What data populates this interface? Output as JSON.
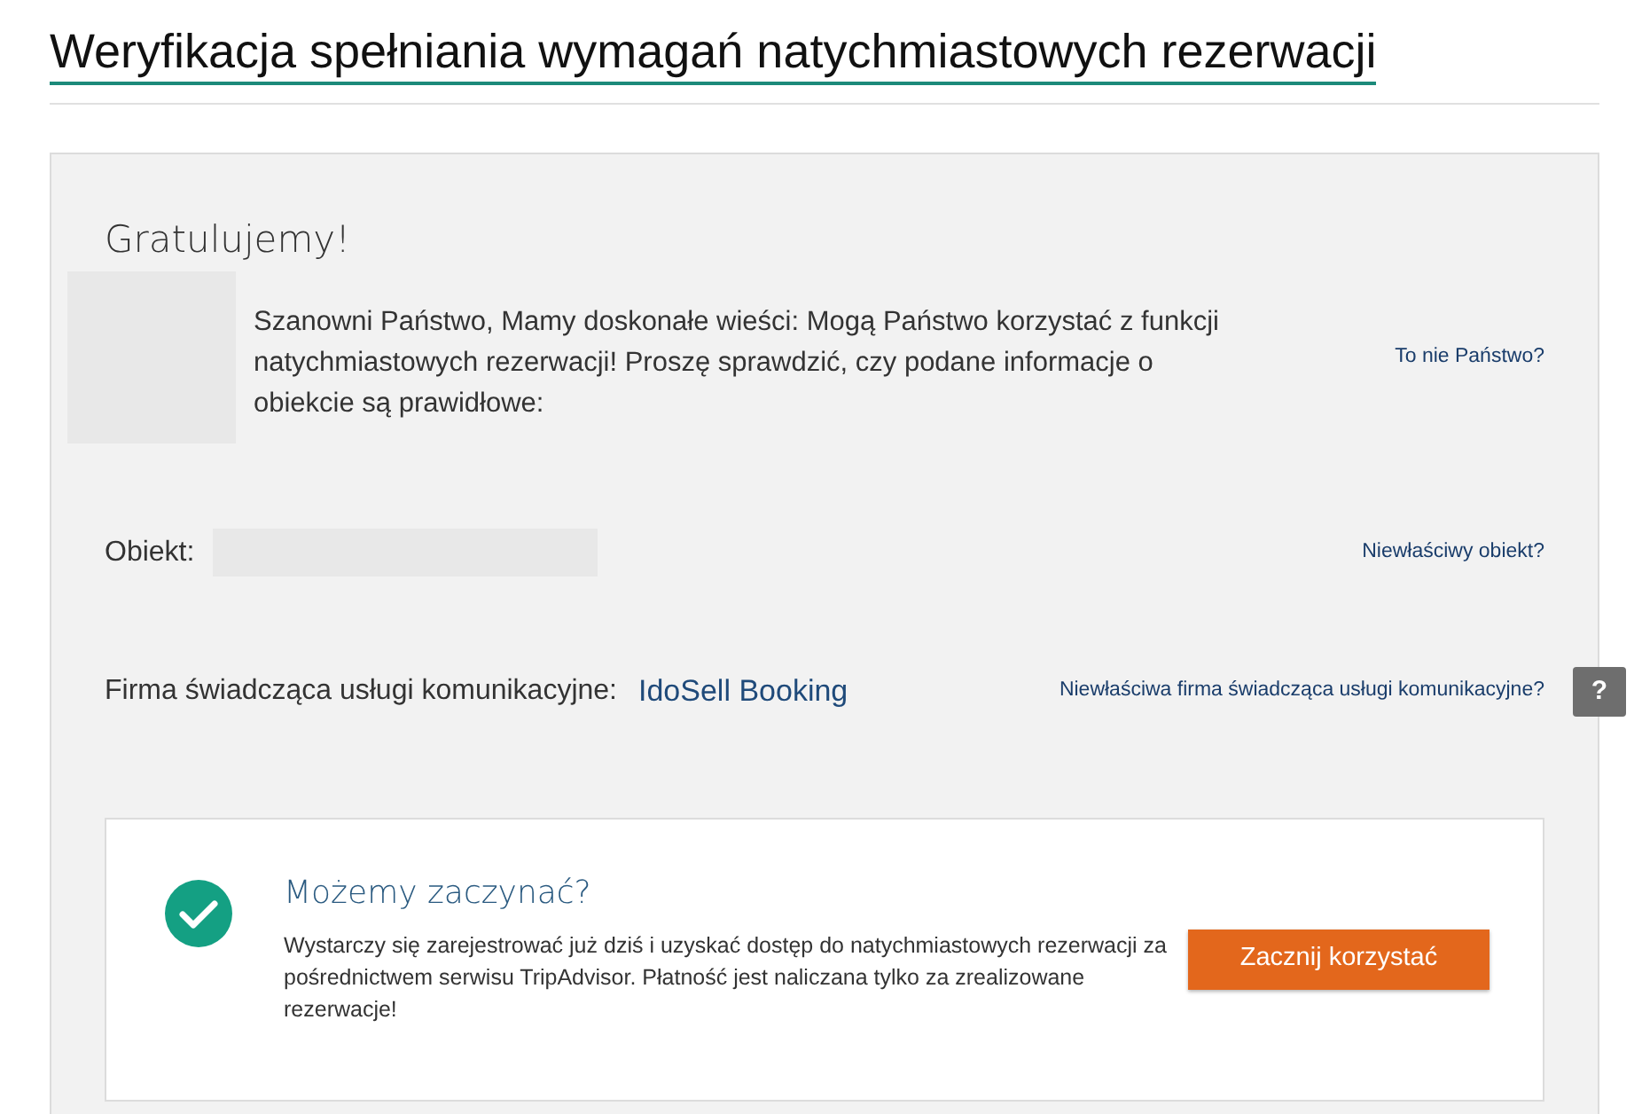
{
  "title": "Weryfikacja spełniania wymagań natychmiastowych rezerwacji",
  "panel": {
    "heading": "Gratulujemy!",
    "message": "Szanowni Państwo, Mamy doskonałe wieści: Mogą Państwo korzystać z funkcji natychmiastowych rezerwacji! Proszę sprawdzić, czy podane informacje o obiekcie są prawidłowe:",
    "message_link": "To nie Państwo?",
    "fields": [
      {
        "kind": "blank",
        "label": "Obiekt:",
        "link": "Niewłaściwy obiekt?"
      },
      {
        "kind": "value",
        "label": "Firma świadcząca usługi komunikacyjne:",
        "value": "IdoSell Booking",
        "link": "Niewłaściwa firma świadcząca usługi komunikacyjne?",
        "help": "?"
      }
    ]
  },
  "card": {
    "heading": "Możemy zaczynać?",
    "text": "Wystarczy się zarejestrować już dziś i uzyskać dostęp do natychmiastowych rezerwacji za pośrednictwem serwisu TripAdvisor. Płatność jest naliczana tylko za zrealizowane rezerwacje!",
    "button": "Zacznij korzystać"
  }
}
